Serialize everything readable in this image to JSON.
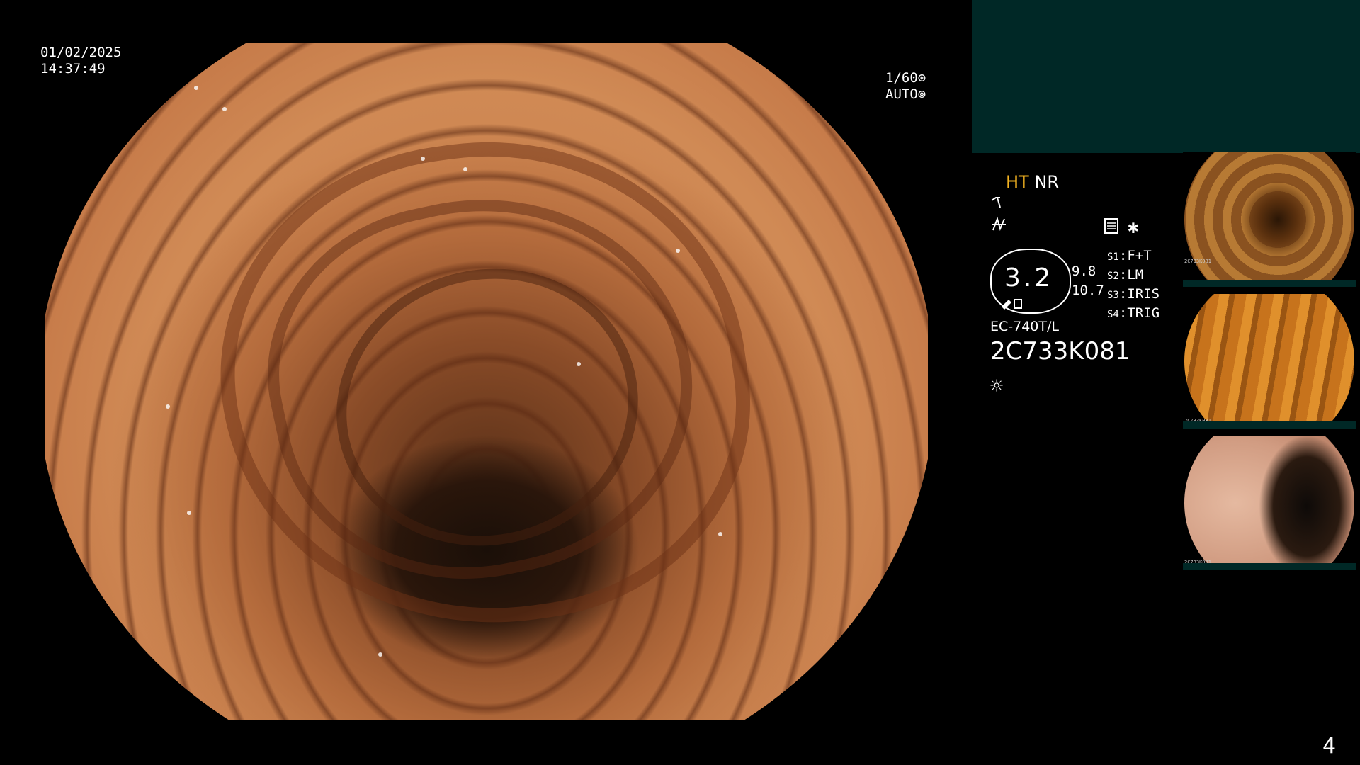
{
  "overlay": {
    "date": "01/02/2025",
    "time": "14:37:49",
    "shutter": "1/60",
    "shutter_icon": "aperture-icon",
    "mode": "AUTO",
    "mode_icon": "iris-icon"
  },
  "panel": {
    "ht_label": "HT",
    "nr_label": "NR",
    "icons": [
      "contrast-curve-icon",
      "edge-enhance-icon",
      "memory-card-icon",
      "asterisk-icon"
    ],
    "enhancement_level": "3.2",
    "side_values": [
      "9.8",
      "10.7"
    ],
    "switches": [
      {
        "key": "S1",
        "value": "F+T"
      },
      {
        "key": "S2",
        "value": "LM"
      },
      {
        "key": "S3",
        "value": "IRIS"
      },
      {
        "key": "S4",
        "value": "TRIG"
      }
    ],
    "model": "EC-740T/L",
    "serial": "2C733K081",
    "light_icon": "light-source-icon"
  },
  "thumbnails": [
    {
      "name": "thumbnail-1",
      "caption": "2C733K081"
    },
    {
      "name": "thumbnail-2",
      "caption": "2C733K081"
    },
    {
      "name": "thumbnail-3",
      "caption": "2C733K081"
    }
  ],
  "page_number": "4",
  "colors": {
    "accent": "#f3b321",
    "panel_teal": "#002826"
  }
}
